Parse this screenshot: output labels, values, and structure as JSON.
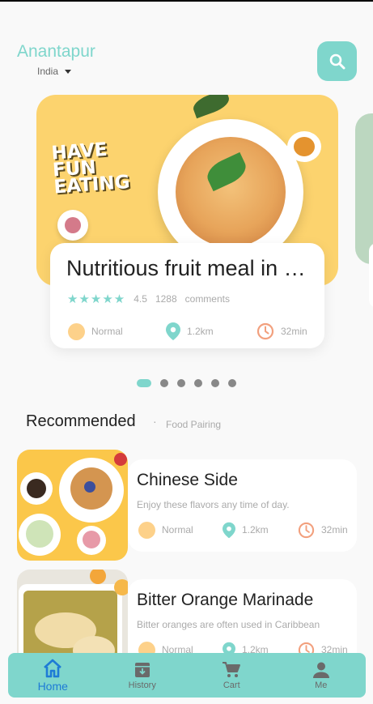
{
  "header": {
    "city": "Anantapur",
    "country": "India",
    "search_icon": "search-icon",
    "accent_color": "#7fd6cc"
  },
  "hero": {
    "slogan": [
      "HAVE",
      "FUN",
      "EATING"
    ],
    "title": "Nutritious fruit meal in China",
    "rating": "4.5",
    "comment_count": "1288",
    "comment_label": "comments",
    "level": "Normal",
    "distance": "1.2km",
    "time": "32min"
  },
  "pagination": {
    "count": 6,
    "active_index": 0
  },
  "recommended": {
    "title": "Recommended",
    "separator": "·",
    "subtitle": "Food Pairing",
    "items": [
      {
        "name": "Chinese Side",
        "description": "Enjoy these flavors any time of day.",
        "level": "Normal",
        "distance": "1.2km",
        "time": "32min"
      },
      {
        "name": "Bitter Orange Marinade",
        "description": "Bitter oranges are often used in Caribbean",
        "level": "Normal",
        "distance": "1.2km",
        "time": "32min"
      }
    ]
  },
  "bottom_nav": {
    "items": [
      {
        "label": "Home",
        "icon": "home-icon",
        "active": true
      },
      {
        "label": "History",
        "icon": "archive-icon",
        "active": false
      },
      {
        "label": "Cart",
        "icon": "cart-icon",
        "active": false
      },
      {
        "label": "Me",
        "icon": "person-icon",
        "active": false
      }
    ]
  }
}
